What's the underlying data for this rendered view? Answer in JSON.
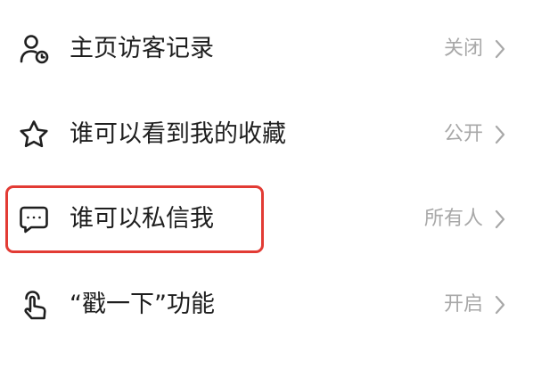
{
  "settings": {
    "items": [
      {
        "icon": "user-clock-icon",
        "label": "主页访客记录",
        "value": "关闭"
      },
      {
        "icon": "star-icon",
        "label": "谁可以看到我的收藏",
        "value": "公开"
      },
      {
        "icon": "chat-bubble-icon",
        "label": "谁可以私信我",
        "value": "所有人"
      },
      {
        "icon": "finger-tap-icon",
        "label": "“戳一下”功能",
        "value": "开启"
      }
    ]
  },
  "colors": {
    "highlight": "#e23b34",
    "label_text": "#1f1f1f",
    "value_text": "#a8a8a8",
    "icon_stroke": "#1f1f1f",
    "background": "#ffffff"
  }
}
